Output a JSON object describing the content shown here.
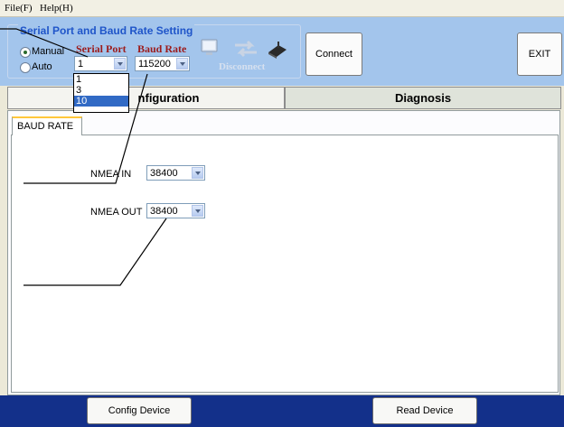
{
  "menu": {
    "file": "File(F)",
    "help": "Help(H)"
  },
  "serial": {
    "group_title": "Serial Port and Baud Rate Setting",
    "mode_manual": "Manual",
    "mode_auto": "Auto",
    "port_label": "Serial Port",
    "baud_label": "Baud Rate",
    "port_value": "1",
    "baud_value": "115200",
    "port_options": [
      "1",
      "3",
      "10"
    ],
    "disconnect_label": "Disconnect"
  },
  "buttons": {
    "connect": "Connect",
    "exit": "EXIT",
    "config_device": "Config Device",
    "read_device": "Read Device"
  },
  "tabs": {
    "configuration": "nfiguration",
    "diagnosis": "Diagnosis"
  },
  "subtab": {
    "baud_rate": "BAUD RATE"
  },
  "fields": {
    "nmea_in_label": "NMEA IN",
    "nmea_in_value": "38400",
    "nmea_out_label": "NMEA OUT",
    "nmea_out_value": "38400"
  },
  "colors": {
    "header_bg": "#a3c5ec",
    "title_blue": "#1f55c9",
    "label_red": "#9c1b1b",
    "bottom_bar": "#13308a",
    "selection": "#316ac5"
  },
  "icons": [
    "computer-icon",
    "transfer-arrows-icon",
    "device-icon"
  ]
}
